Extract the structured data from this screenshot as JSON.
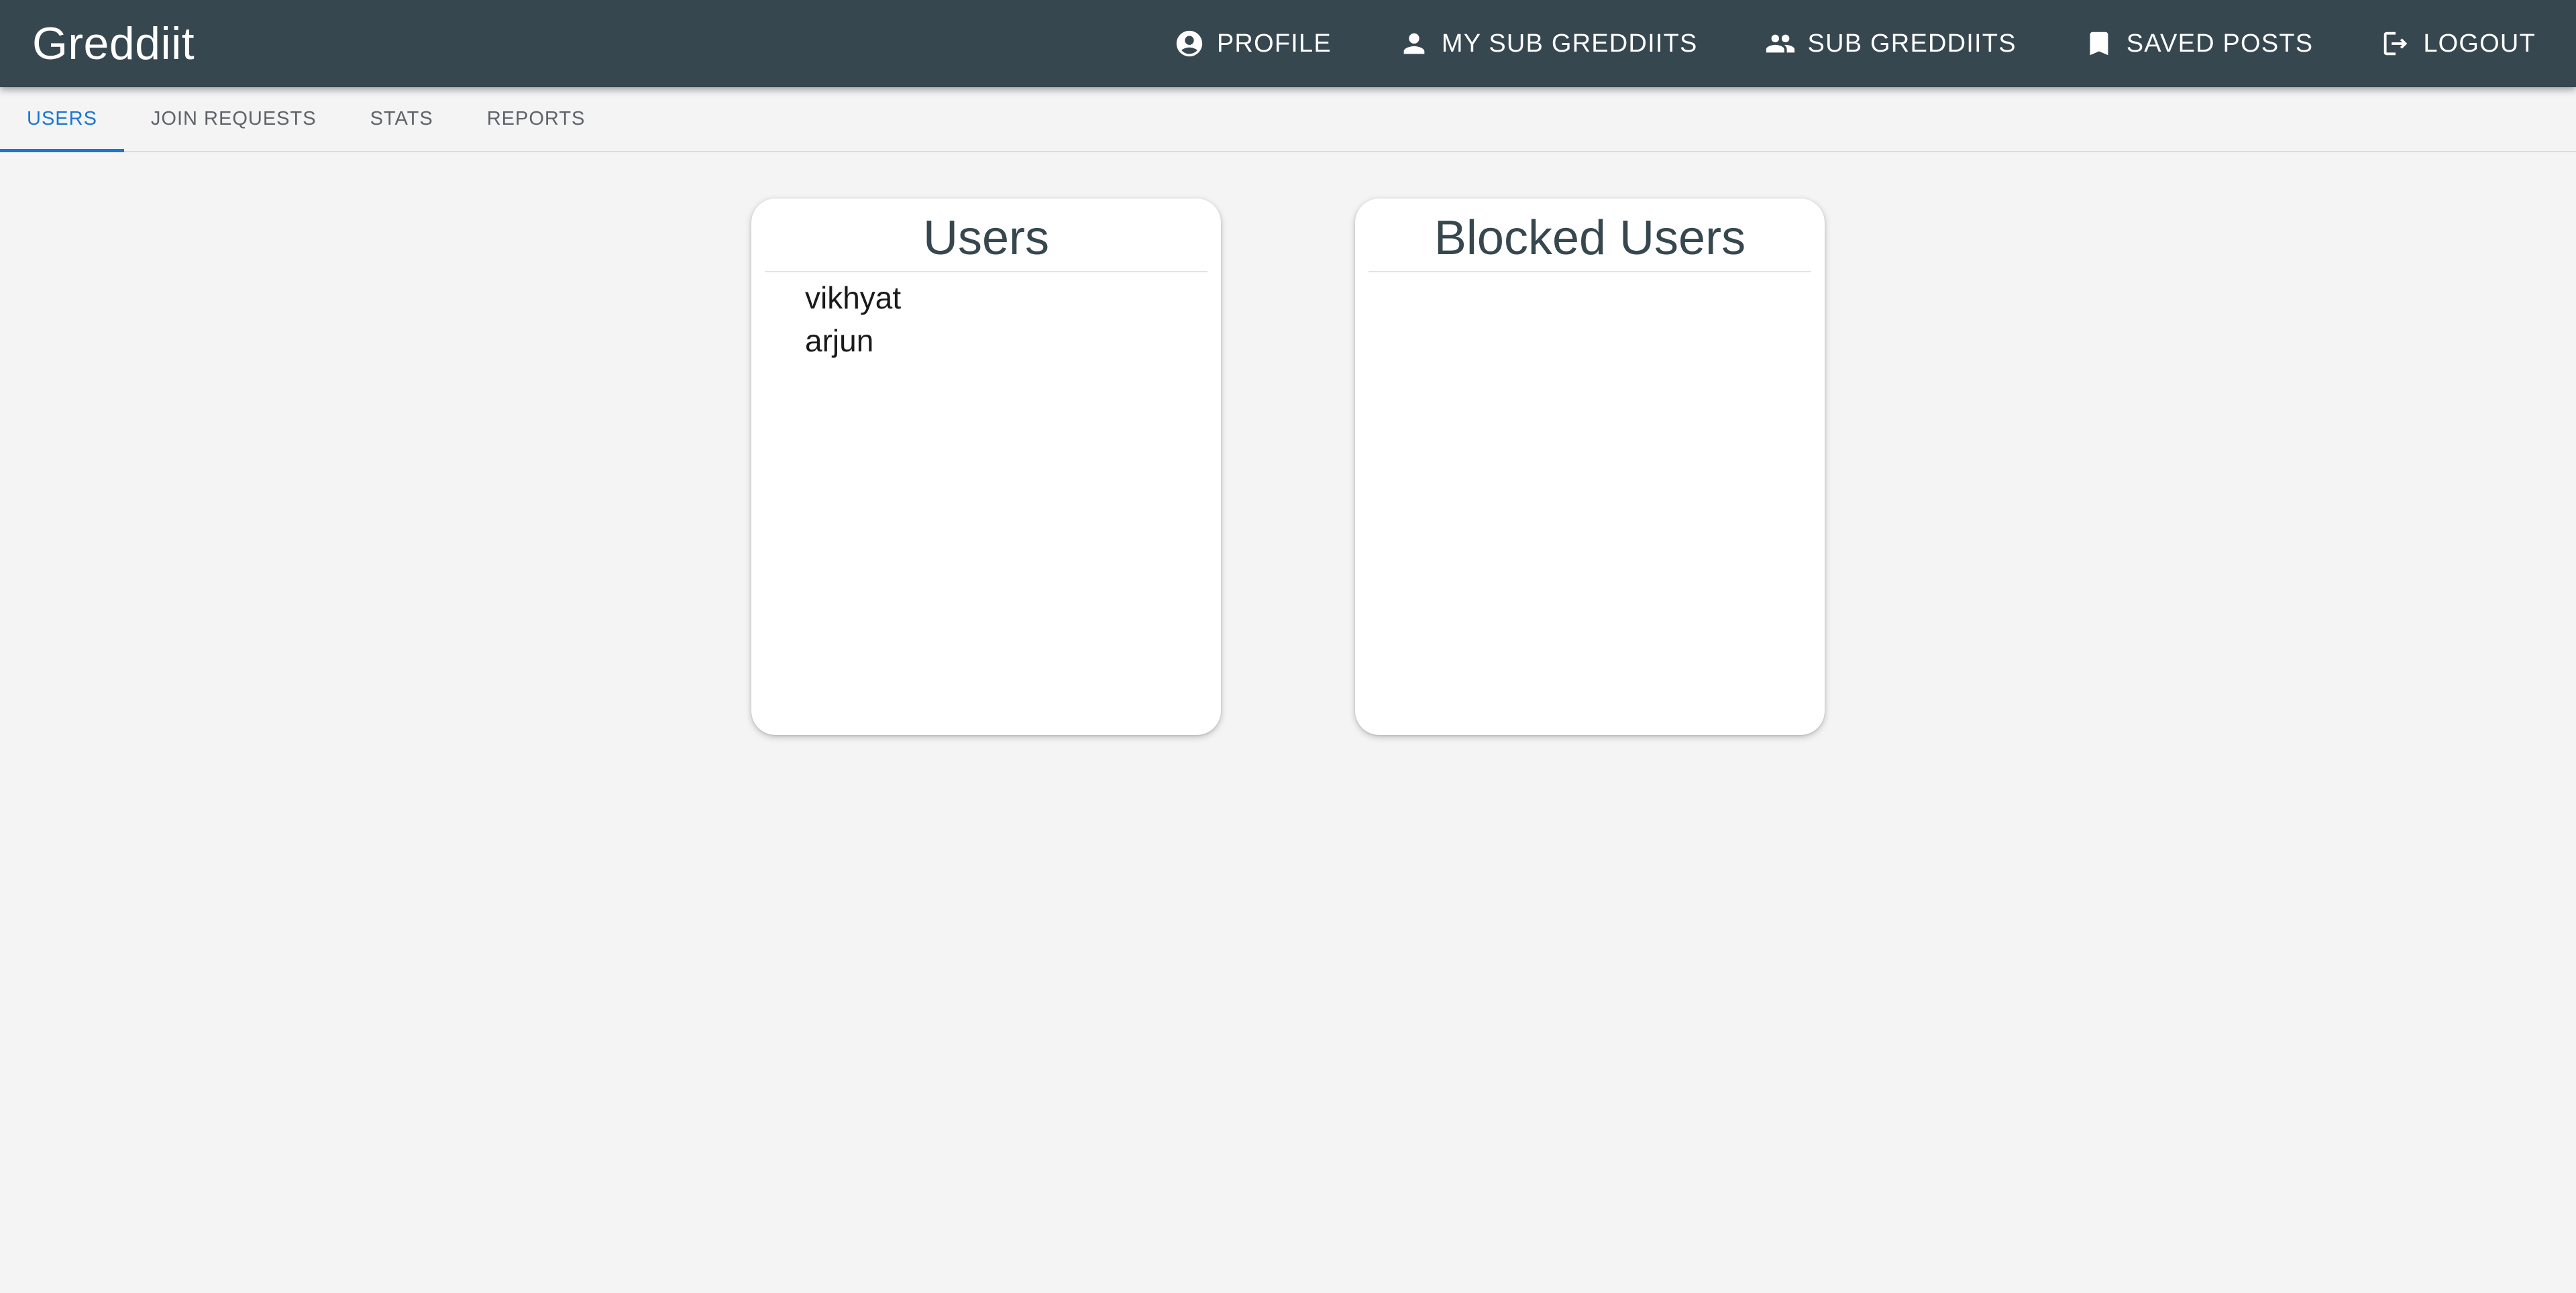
{
  "app": {
    "brand": "Greddiit"
  },
  "nav": {
    "items": [
      {
        "label": "PROFILE",
        "icon": "account-circle-icon"
      },
      {
        "label": "MY SUB GREDDIITS",
        "icon": "person-icon"
      },
      {
        "label": "SUB GREDDIITS",
        "icon": "people-icon"
      },
      {
        "label": "SAVED POSTS",
        "icon": "bookmark-icon"
      },
      {
        "label": "LOGOUT",
        "icon": "logout-icon"
      }
    ]
  },
  "tabs": {
    "items": [
      {
        "label": "USERS",
        "active": true
      },
      {
        "label": "JOIN REQUESTS",
        "active": false
      },
      {
        "label": "STATS",
        "active": false
      },
      {
        "label": "REPORTS",
        "active": false
      }
    ],
    "accent_color": "#1976d2"
  },
  "users_card": {
    "title": "Users",
    "users": [
      "vikhyat",
      "arjun"
    ]
  },
  "blocked_card": {
    "title": "Blocked Users",
    "users": []
  },
  "colors": {
    "appbar": "#37474f",
    "background": "#f4f4f4",
    "card": "#ffffff"
  }
}
